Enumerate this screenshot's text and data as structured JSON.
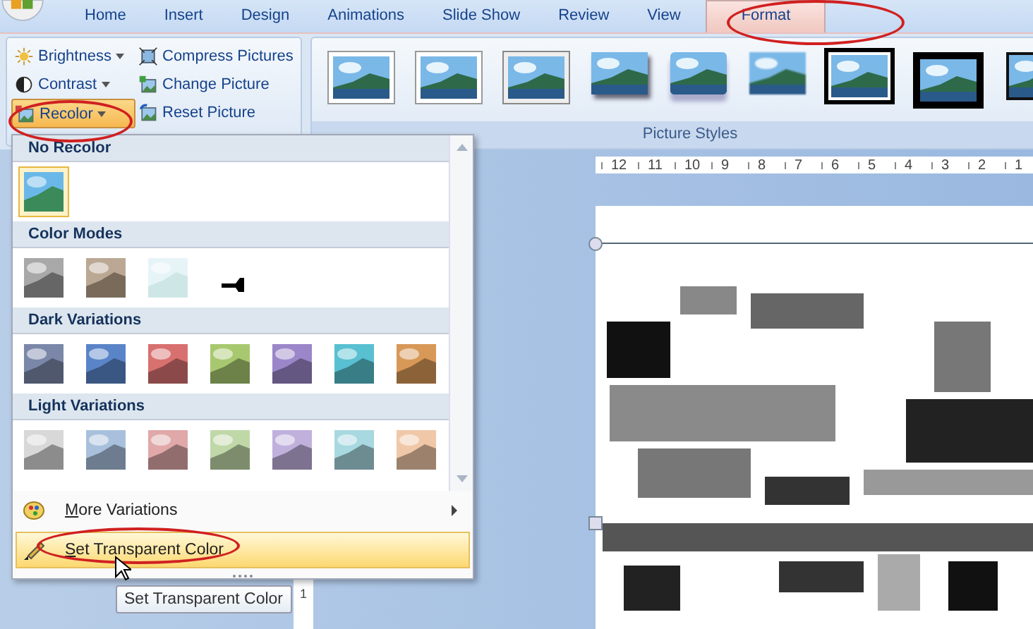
{
  "tabs": [
    {
      "label": "Home",
      "selected": false
    },
    {
      "label": "Insert",
      "selected": false
    },
    {
      "label": "Design",
      "selected": false
    },
    {
      "label": "Animations",
      "selected": false
    },
    {
      "label": "Slide Show",
      "selected": false
    },
    {
      "label": "Review",
      "selected": false
    },
    {
      "label": "View",
      "selected": false
    },
    {
      "label": "Format",
      "selected": true
    }
  ],
  "adjust_buttons": [
    {
      "label": "Brightness",
      "kind": "sun",
      "dropdown": true,
      "pressed": false
    },
    {
      "label": "Compress Pictures",
      "kind": "compress",
      "dropdown": false,
      "pressed": false
    },
    {
      "label": "Contrast",
      "kind": "contrast",
      "dropdown": true,
      "pressed": false
    },
    {
      "label": "Change Picture",
      "kind": "change",
      "dropdown": false,
      "pressed": false
    },
    {
      "label": "Recolor",
      "kind": "recolor",
      "dropdown": true,
      "pressed": true
    },
    {
      "label": "Reset Picture",
      "kind": "reset",
      "dropdown": false,
      "pressed": false
    }
  ],
  "picture_styles": {
    "label": "Picture Styles",
    "styles": [
      {
        "kind": "white-frame"
      },
      {
        "kind": "white-frame"
      },
      {
        "kind": "grey-frame"
      },
      {
        "kind": "shadow"
      },
      {
        "kind": "reflection"
      },
      {
        "kind": "soft-edge"
      },
      {
        "kind": "double-black"
      },
      {
        "kind": "thick-black"
      },
      {
        "kind": "thin-black"
      }
    ]
  },
  "ruler": [
    "12",
    "11",
    "10",
    "9",
    "8",
    "7",
    "6",
    "5",
    "4",
    "3",
    "2",
    "1"
  ],
  "vertical_ruler": [
    "1"
  ],
  "recolor_menu": {
    "sections": [
      {
        "title": "No Recolor",
        "swatches": [
          {
            "kind": "original",
            "selected": true
          }
        ]
      },
      {
        "title": "Color Modes",
        "swatches": [
          {
            "kind": "grayscale",
            "selected": false
          },
          {
            "kind": "sepia",
            "selected": false
          },
          {
            "kind": "washout",
            "selected": false
          },
          {
            "kind": "black-white",
            "selected": false
          }
        ]
      },
      {
        "title": "Dark Variations",
        "swatches": [
          {
            "kind": "tint",
            "color": "#7a87a8",
            "selected": false
          },
          {
            "kind": "tint",
            "color": "#5a84c8",
            "selected": false
          },
          {
            "kind": "tint",
            "color": "#d87070",
            "selected": false
          },
          {
            "kind": "tint",
            "color": "#a8c870",
            "selected": false
          },
          {
            "kind": "tint",
            "color": "#9a86c8",
            "selected": false
          },
          {
            "kind": "tint",
            "color": "#58c0d0",
            "selected": false
          },
          {
            "kind": "tint",
            "color": "#d89858",
            "selected": false
          }
        ]
      },
      {
        "title": "Light Variations",
        "swatches": [
          {
            "kind": "tint",
            "color": "#d8d8d8",
            "selected": false
          },
          {
            "kind": "tint",
            "color": "#a8c0dc",
            "selected": false
          },
          {
            "kind": "tint",
            "color": "#e0a8a8",
            "selected": false
          },
          {
            "kind": "tint",
            "color": "#c0d8a8",
            "selected": false
          },
          {
            "kind": "tint",
            "color": "#c0b0dc",
            "selected": false
          },
          {
            "kind": "tint",
            "color": "#a8d8e0",
            "selected": false
          },
          {
            "kind": "tint",
            "color": "#f0c8a8",
            "selected": false
          }
        ]
      }
    ],
    "items": [
      {
        "label": "More Variations",
        "kind": "submenu",
        "highlighted": false
      },
      {
        "label": "Set Transparent Color",
        "kind": "pencil",
        "highlighted": true
      }
    ]
  },
  "tooltip": "Set Transparent Color"
}
